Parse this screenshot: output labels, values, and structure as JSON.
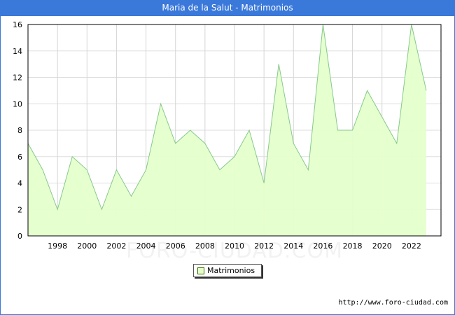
{
  "header": {
    "title": "Maria de la Salut - Matrimonios"
  },
  "chart_data": {
    "type": "area",
    "title": "Maria de la Salut - Matrimonios",
    "xlabel": "",
    "ylabel": "",
    "x": [
      1996,
      1997,
      1998,
      1999,
      2000,
      2001,
      2002,
      2003,
      2004,
      2005,
      2006,
      2007,
      2008,
      2009,
      2010,
      2011,
      2012,
      2013,
      2014,
      2015,
      2016,
      2017,
      2018,
      2019,
      2020,
      2021,
      2022,
      2023
    ],
    "series": [
      {
        "name": "Matrimonios",
        "values": [
          7,
          5,
          2,
          6,
          5,
          2,
          5,
          3,
          5,
          10,
          7,
          8,
          7,
          5,
          6,
          8,
          4,
          13,
          7,
          5,
          16,
          8,
          8,
          11,
          9,
          7,
          16,
          11
        ]
      }
    ],
    "x_ticks": [
      "1998",
      "2000",
      "2002",
      "2004",
      "2006",
      "2008",
      "2010",
      "2012",
      "2014",
      "2016",
      "2018",
      "2020",
      "2022"
    ],
    "y_ticks": [
      "0",
      "2",
      "4",
      "6",
      "8",
      "10",
      "12",
      "14",
      "16"
    ],
    "xlim": [
      1996,
      2024
    ],
    "ylim": [
      0,
      16
    ],
    "grid": true,
    "legend_position": "bottom-center",
    "colors": {
      "fill": "#e5ffcc",
      "line": "#86c98c",
      "header": "#3a78da"
    }
  },
  "legend": {
    "label": "Matrimonios"
  },
  "watermark": {
    "text": "FORO-CIUDAD.COM"
  },
  "source": {
    "text": "http://www.foro-ciudad.com"
  }
}
